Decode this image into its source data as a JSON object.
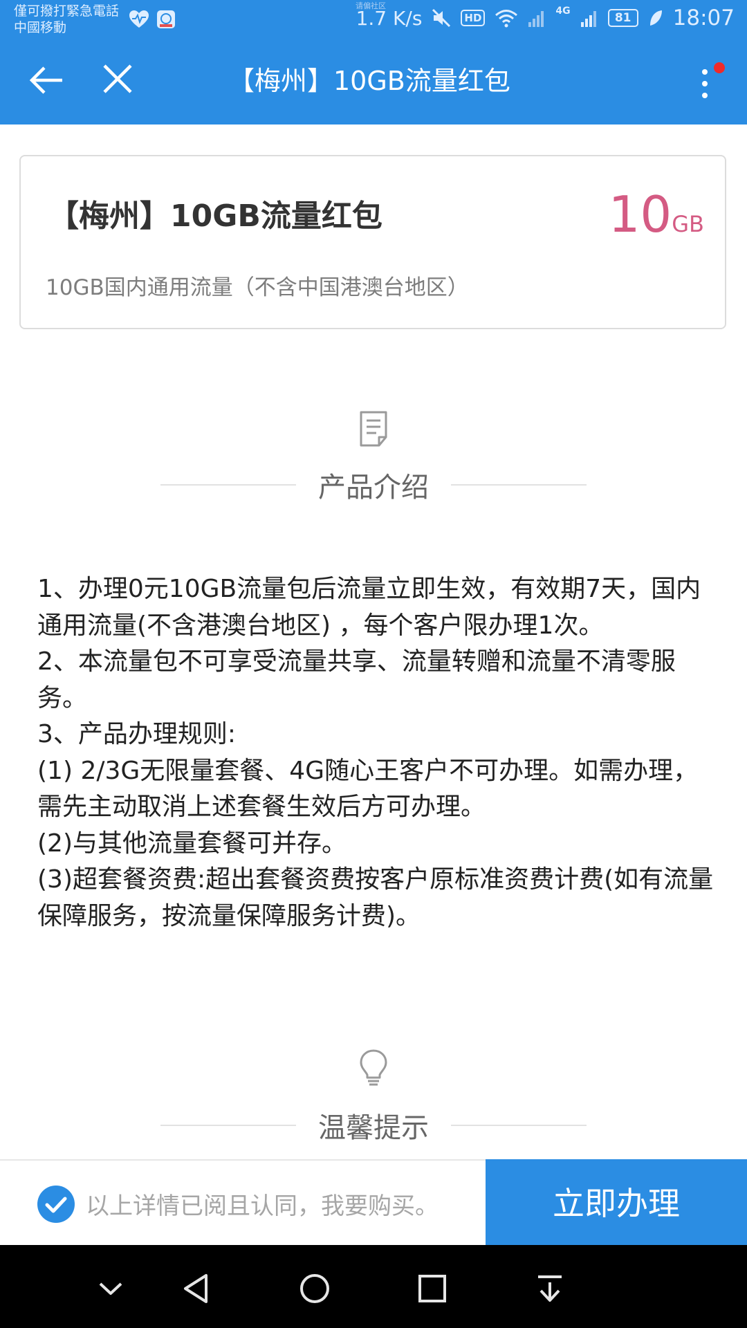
{
  "status_bar": {
    "emergency_text": "僅可撥打緊急電話",
    "carrier": "中國移動",
    "watermark": "请偏社区",
    "speed": "1.7 K/s",
    "hd_label": "HD",
    "network_label": "4G",
    "battery": "81",
    "time": "18:07"
  },
  "app_bar": {
    "title": "【梅州】10GB流量红包"
  },
  "product": {
    "title": "【梅州】10GB流量红包",
    "amount": "10",
    "unit": "GB",
    "description": "10GB国内通用流量（不含中国港澳台地区）"
  },
  "sections": {
    "intro_title": "产品介绍",
    "tips_title": "温馨提示"
  },
  "rules": [
    "1、办理0元10GB流量包后流量立即生效，有效期7天，国内通用流量(不含港澳台地区) ，每个客户限办理1次。",
    "2、本流量包不可享受流量共享、流量转赠和流量不清零服务。",
    "3、产品办理规则:",
    "(1) 2/3G无限量套餐、4G随心王客户不可办理。如需办理，需先主动取消上述套餐生效后方可办理。",
    "(2)与其他流量套餐可并存。",
    "(3)超套餐资费:超出套餐资费按客户原标准资费计费(如有流量保障服务，按流量保障服务计费)。"
  ],
  "bottom_bar": {
    "agree_text": "以上详情已阅且认同，我要购买。",
    "submit_label": "立即办理"
  },
  "colors": {
    "primary": "#2b8de3",
    "amount": "#d45b83",
    "badge_dot": "#ef2a2a"
  }
}
